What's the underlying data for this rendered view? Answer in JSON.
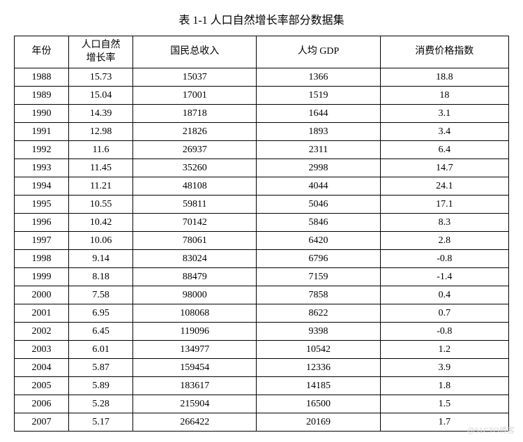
{
  "title": "表 1-1 人口自然增长率部分数据集",
  "columns": [
    "年份",
    "人口自然\n增长率",
    "国民总收入",
    "人均 GDP",
    "消费价格指数"
  ],
  "rows": [
    {
      "year": "1988",
      "growth": "15.73",
      "income": "15037",
      "gdp": "1366",
      "cpi": "18.8"
    },
    {
      "year": "1989",
      "growth": "15.04",
      "income": "17001",
      "gdp": "1519",
      "cpi": "18"
    },
    {
      "year": "1990",
      "growth": "14.39",
      "income": "18718",
      "gdp": "1644",
      "cpi": "3.1"
    },
    {
      "year": "1991",
      "growth": "12.98",
      "income": "21826",
      "gdp": "1893",
      "cpi": "3.4"
    },
    {
      "year": "1992",
      "growth": "11.6",
      "income": "26937",
      "gdp": "2311",
      "cpi": "6.4"
    },
    {
      "year": "1993",
      "growth": "11.45",
      "income": "35260",
      "gdp": "2998",
      "cpi": "14.7"
    },
    {
      "year": "1994",
      "growth": "11.21",
      "income": "48108",
      "gdp": "4044",
      "cpi": "24.1"
    },
    {
      "year": "1995",
      "growth": "10.55",
      "income": "59811",
      "gdp": "5046",
      "cpi": "17.1"
    },
    {
      "year": "1996",
      "growth": "10.42",
      "income": "70142",
      "gdp": "5846",
      "cpi": "8.3"
    },
    {
      "year": "1997",
      "growth": "10.06",
      "income": "78061",
      "gdp": "6420",
      "cpi": "2.8"
    },
    {
      "year": "1998",
      "growth": "9.14",
      "income": "83024",
      "gdp": "6796",
      "cpi": "-0.8"
    },
    {
      "year": "1999",
      "growth": "8.18",
      "income": "88479",
      "gdp": "7159",
      "cpi": "-1.4"
    },
    {
      "year": "2000",
      "growth": "7.58",
      "income": "98000",
      "gdp": "7858",
      "cpi": "0.4"
    },
    {
      "year": "2001",
      "growth": "6.95",
      "income": "108068",
      "gdp": "8622",
      "cpi": "0.7"
    },
    {
      "year": "2002",
      "growth": "6.45",
      "income": "119096",
      "gdp": "9398",
      "cpi": "-0.8"
    },
    {
      "year": "2003",
      "growth": "6.01",
      "income": "134977",
      "gdp": "10542",
      "cpi": "1.2"
    },
    {
      "year": "2004",
      "growth": "5.87",
      "income": "159454",
      "gdp": "12336",
      "cpi": "3.9"
    },
    {
      "year": "2005",
      "growth": "5.89",
      "income": "183617",
      "gdp": "14185",
      "cpi": "1.8"
    },
    {
      "year": "2006",
      "growth": "5.28",
      "income": "215904",
      "gdp": "16500",
      "cpi": "1.5"
    },
    {
      "year": "2007",
      "growth": "5.17",
      "income": "266422",
      "gdp": "20169",
      "cpi": "1.7"
    }
  ],
  "watermark": "@51CTO博客",
  "chart_data": {
    "type": "table",
    "title": "表 1-1 人口自然增长率部分数据集",
    "columns": [
      "年份",
      "人口自然增长率",
      "国民总收入",
      "人均 GDP",
      "消费价格指数"
    ],
    "rows": [
      [
        1988,
        15.73,
        15037,
        1366,
        18.8
      ],
      [
        1989,
        15.04,
        17001,
        1519,
        18
      ],
      [
        1990,
        14.39,
        18718,
        1644,
        3.1
      ],
      [
        1991,
        12.98,
        21826,
        1893,
        3.4
      ],
      [
        1992,
        11.6,
        26937,
        2311,
        6.4
      ],
      [
        1993,
        11.45,
        35260,
        2998,
        14.7
      ],
      [
        1994,
        11.21,
        48108,
        4044,
        24.1
      ],
      [
        1995,
        10.55,
        59811,
        5046,
        17.1
      ],
      [
        1996,
        10.42,
        70142,
        5846,
        8.3
      ],
      [
        1997,
        10.06,
        78061,
        6420,
        2.8
      ],
      [
        1998,
        9.14,
        83024,
        6796,
        -0.8
      ],
      [
        1999,
        8.18,
        88479,
        7159,
        -1.4
      ],
      [
        2000,
        7.58,
        98000,
        7858,
        0.4
      ],
      [
        2001,
        6.95,
        108068,
        8622,
        0.7
      ],
      [
        2002,
        6.45,
        119096,
        9398,
        -0.8
      ],
      [
        2003,
        6.01,
        134977,
        10542,
        1.2
      ],
      [
        2004,
        5.87,
        159454,
        12336,
        3.9
      ],
      [
        2005,
        5.89,
        183617,
        14185,
        1.8
      ],
      [
        2006,
        5.28,
        215904,
        16500,
        1.5
      ],
      [
        2007,
        5.17,
        266422,
        20169,
        1.7
      ]
    ]
  }
}
